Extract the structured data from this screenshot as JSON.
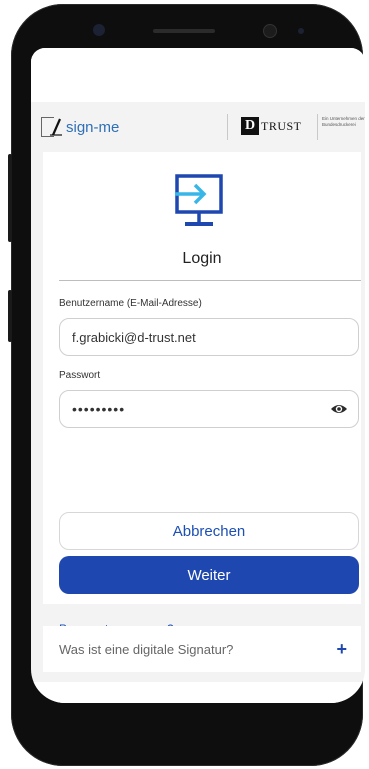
{
  "brand": {
    "signme": "sign-me",
    "dtrust_letter": "D",
    "dtrust_text": "TRUST",
    "bundesdruckerei": "Ein Unternehmen der Bundesdruckerei"
  },
  "login": {
    "title": "Login",
    "username_label": "Benutzername (E-Mail-Adresse)",
    "username_value": "f.grabicki@d-trust.net",
    "password_label": "Passwort",
    "password_value": "•••••••••",
    "cancel_label": "Abbrechen",
    "continue_label": "Weiter",
    "forgot_label": "Passwort vergessen?"
  },
  "faq": {
    "label": "Was ist eine digitale Signatur?",
    "expand_symbol": "+"
  },
  "colors": {
    "accent": "#1f47b0",
    "icon_blue": "#1f47b0",
    "icon_cyan": "#39b6e8"
  }
}
